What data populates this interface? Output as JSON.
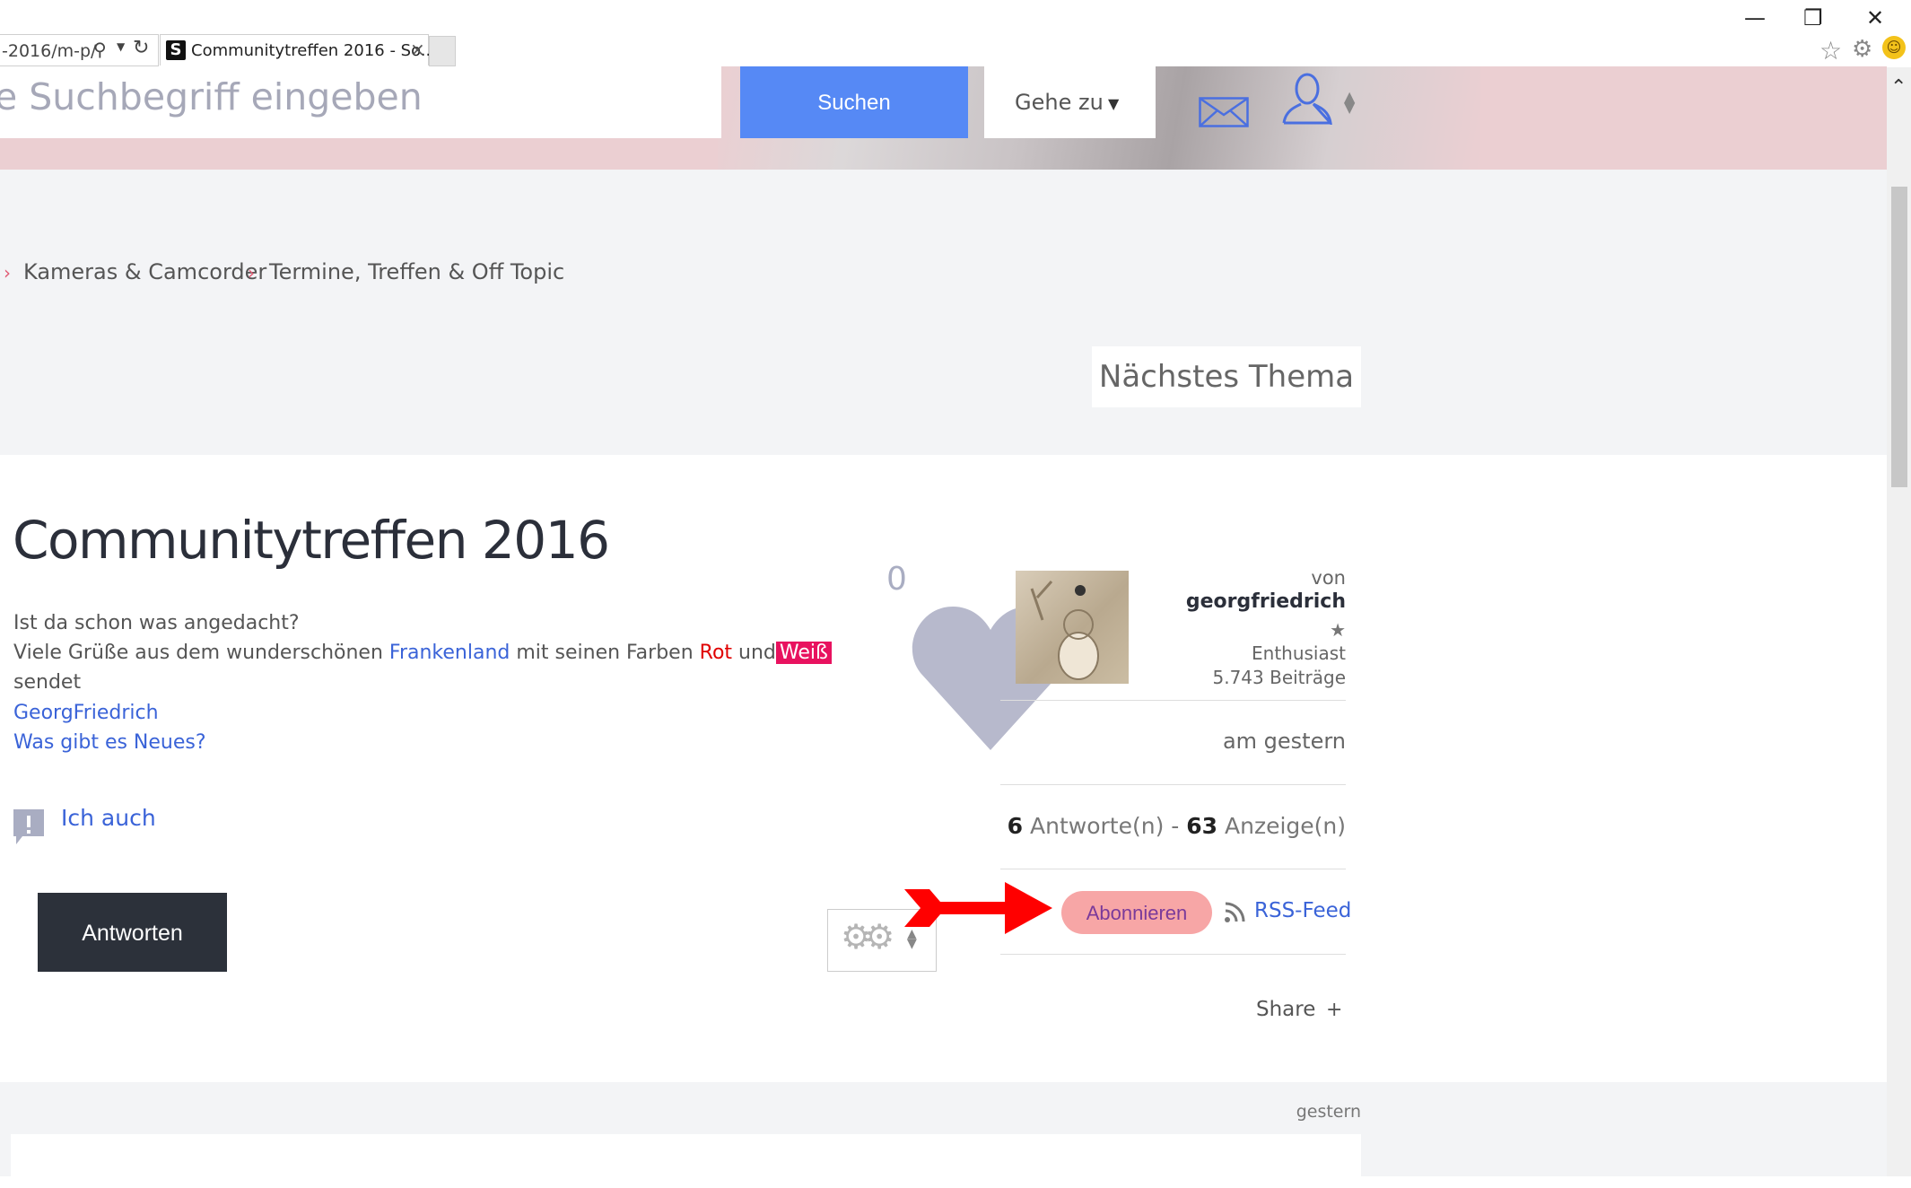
{
  "browser": {
    "address": "-2016/m-p/",
    "tab_title": "Communitytreffen 2016 - So...",
    "tab_favicon": "S",
    "window": {
      "minimize": "—",
      "restore": "❐",
      "close": "✕"
    }
  },
  "header": {
    "search_placeholder": "e Suchbegriff eingeben",
    "search_button": "Suchen",
    "goto_label": "Gehe zu",
    "icons": {
      "mail": "mail-icon",
      "user": "user-icon"
    }
  },
  "breadcrumb": {
    "items": [
      "Kameras & Camcorder",
      "Termine, Treffen & Off Topic"
    ]
  },
  "nav": {
    "next_topic": "Nächstes Thema"
  },
  "post": {
    "title": "Communitytreffen 2016",
    "line1": "Ist da schon was angedacht?",
    "line2_a": "Viele Grüße aus dem wunderschönen ",
    "line2_link": "Frankenland",
    "line2_b": " mit seinen Farben ",
    "line2_rot": "Rot",
    "line2_und": " und",
    "line2_weiss": "Weiß",
    "line3": "sendet",
    "signature_name": "GeorgFriedrich",
    "signature_link": "Was gibt es Neues?",
    "metoo_label": "Ich auch",
    "reply_button": "Antworten"
  },
  "author": {
    "kudos": "0",
    "von": "von",
    "name": "georgfriedrich",
    "rank_star": "★",
    "rank": "Enthusiast",
    "posts": "5.743 Beiträge",
    "date": "am gestern"
  },
  "stats": {
    "replies_count": "6",
    "replies_label": " Antworte(n) - ",
    "views_count": "63",
    "views_label": " Anzeige(n)"
  },
  "actions": {
    "subscribe": "Abonnieren",
    "rss": "RSS-Feed",
    "share": "Share",
    "share_plus": "+"
  },
  "reply": {
    "date": "gestern"
  },
  "colors": {
    "search_button": "#5689f5",
    "header_bg": "#ebcfd2",
    "reply_button": "#2c313a",
    "link": "#3a63d8",
    "highlight_weiss": "#e8125f",
    "subscribe_highlight": "#f7a6a6",
    "arrow": "#ff0000"
  }
}
